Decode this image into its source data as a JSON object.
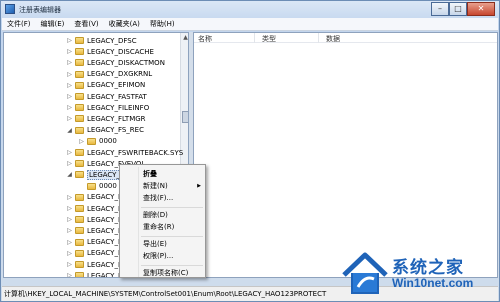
{
  "window": {
    "title": "注册表编辑器",
    "buttons": [
      "–",
      "□",
      "✕"
    ]
  },
  "menubar": [
    "文件(F)",
    "编辑(E)",
    "查看(V)",
    "收藏夹(A)",
    "帮助(H)"
  ],
  "tree": [
    {
      "label": "LEGACY_DFSC",
      "expander": "▷",
      "indent": 1
    },
    {
      "label": "LEGACY_DISCACHE",
      "expander": "▷",
      "indent": 1
    },
    {
      "label": "LEGACY_DISKACTMON",
      "expander": "▷",
      "indent": 1
    },
    {
      "label": "LEGACY_DXGKRNL",
      "expander": "▷",
      "indent": 1
    },
    {
      "label": "LEGACY_EFIMON",
      "expander": "▷",
      "indent": 1
    },
    {
      "label": "LEGACY_FASTFAT",
      "expander": "▷",
      "indent": 1
    },
    {
      "label": "LEGACY_FILEINFO",
      "expander": "▷",
      "indent": 1
    },
    {
      "label": "LEGACY_FLTMGR",
      "expander": "▷",
      "indent": 1
    },
    {
      "label": "LEGACY_FS_REC",
      "expander": "◢",
      "indent": 1
    },
    {
      "label": "0000",
      "expander": "▷",
      "indent": 2
    },
    {
      "label": "LEGACY_FSWRITEBACK.SYS",
      "expander": "▷",
      "indent": 1
    },
    {
      "label": "LEGACY_FVEVOL",
      "expander": "▷",
      "indent": 1
    },
    {
      "label": "LEGACY_HAO123PROTECT",
      "expander": "◢",
      "indent": 1,
      "selected": true
    },
    {
      "label": "0000",
      "expander": "",
      "indent": 2
    },
    {
      "label": "LEGACY_HO",
      "expander": "▷",
      "indent": 1
    },
    {
      "label": "LEGACY_HT",
      "expander": "▷",
      "indent": 1
    },
    {
      "label": "LEGACY_HV",
      "expander": "▷",
      "indent": 1
    },
    {
      "label": "LEGACY_IP",
      "expander": "▷",
      "indent": 1
    },
    {
      "label": "LEGACY_KE",
      "expander": "▷",
      "indent": 1
    },
    {
      "label": "LEGACY_KS",
      "expander": "▷",
      "indent": 1
    },
    {
      "label": "LEGACY_KS",
      "expander": "▷",
      "indent": 1
    },
    {
      "label": "LEGACY_LL",
      "expander": "▷",
      "indent": 1
    },
    {
      "label": "LEGACY_LU",
      "expander": "▷",
      "indent": 1
    }
  ],
  "list": {
    "columns": [
      "名称",
      "类型",
      "数据"
    ]
  },
  "context_menu": {
    "items": [
      {
        "label": "折叠",
        "bold": true
      },
      {
        "label": "新建(N)",
        "submenu": true
      },
      {
        "label": "查找(F)..."
      },
      {
        "sep": true
      },
      {
        "label": "删除(D)"
      },
      {
        "label": "重命名(R)"
      },
      {
        "sep": true
      },
      {
        "label": "导出(E)"
      },
      {
        "label": "权限(P)..."
      },
      {
        "sep": true
      },
      {
        "label": "复制项名称(C)"
      }
    ]
  },
  "statusbar": "计算机\\HKEY_LOCAL_MACHINE\\SYSTEM\\ControlSet001\\Enum\\Root\\LEGACY_HAO123PROTECT",
  "watermark": {
    "cn": "系统之家",
    "en": "Win10net.com"
  }
}
